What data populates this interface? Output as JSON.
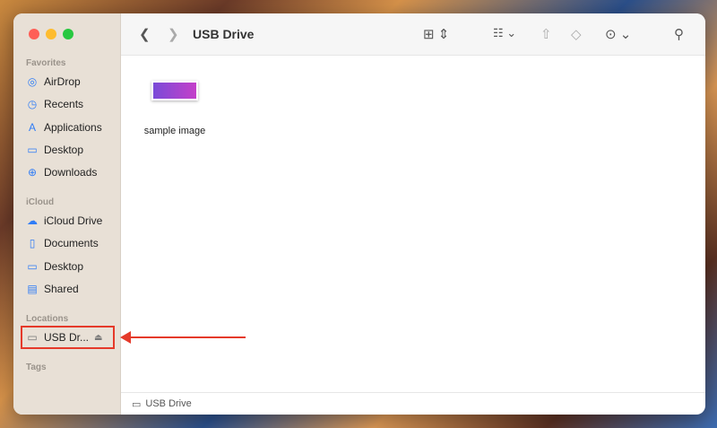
{
  "window": {
    "title": "USB Drive"
  },
  "sidebar": {
    "favorites_label": "Favorites",
    "favorites": [
      {
        "label": "AirDrop",
        "icon": "airdrop-icon"
      },
      {
        "label": "Recents",
        "icon": "clock-icon"
      },
      {
        "label": "Applications",
        "icon": "applications-icon"
      },
      {
        "label": "Desktop",
        "icon": "desktop-icon"
      },
      {
        "label": "Downloads",
        "icon": "downloads-icon"
      }
    ],
    "icloud_label": "iCloud",
    "icloud": [
      {
        "label": "iCloud Drive",
        "icon": "cloud-icon"
      },
      {
        "label": "Documents",
        "icon": "document-icon"
      },
      {
        "label": "Desktop",
        "icon": "desktop-icon"
      },
      {
        "label": "Shared",
        "icon": "shared-folder-icon"
      }
    ],
    "locations_label": "Locations",
    "locations": [
      {
        "label": "USB Dr...",
        "icon": "drive-icon"
      }
    ],
    "tags_label": "Tags"
  },
  "files": [
    {
      "name": "sample image"
    }
  ],
  "pathbar": {
    "label": "USB Drive"
  },
  "annotation": {
    "color": "#e53a2a"
  }
}
